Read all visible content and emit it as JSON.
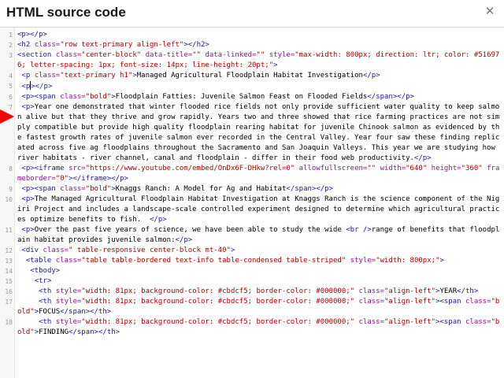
{
  "dialog": {
    "title": "HTML source code",
    "close_glyph": "✕"
  },
  "colors": {
    "tag": "#1a1aa6",
    "attribute": "#8b1a8b",
    "value": "#b30000",
    "marker": "#ff0000"
  },
  "lines": [
    {
      "num": "1",
      "tokens": [
        [
          "t",
          "<p></p>"
        ]
      ]
    },
    {
      "num": "2",
      "tokens": [
        [
          "t",
          "<h2 "
        ],
        [
          "a",
          "class="
        ],
        [
          "v",
          "\"row text-primary align-left\""
        ],
        [
          "t",
          "></h2>"
        ]
      ]
    },
    {
      "num": "3",
      "tokens": [
        [
          "t",
          "<section "
        ],
        [
          "a",
          "class="
        ],
        [
          "v",
          "\"center-block\" "
        ],
        [
          "a",
          "data-title="
        ],
        [
          "v",
          "\"\" "
        ],
        [
          "a",
          "data-linked="
        ],
        [
          "v",
          "\"\" "
        ],
        [
          "a",
          "style="
        ],
        [
          "v",
          "\"max-width: 800px; direction: ltr; color: #516976; letter-spacing: 1px; font-size: 14px; line-height: 20pt;\""
        ],
        [
          "t",
          ">"
        ]
      ]
    },
    {
      "num": "4",
      "tokens": [
        [
          "n",
          " "
        ],
        [
          "t",
          "<p "
        ],
        [
          "a",
          "class="
        ],
        [
          "v",
          "\"text-primary h1\""
        ],
        [
          "t",
          ">"
        ],
        [
          "n",
          "Managed Agricultural Floodplain Habitat Investigation"
        ],
        [
          "t",
          "</p>"
        ]
      ]
    },
    {
      "num": "5",
      "tokens": [
        [
          "n",
          " "
        ],
        [
          "t",
          "<p"
        ],
        [
          "c",
          ""
        ],
        [
          "t",
          "></p>"
        ]
      ]
    },
    {
      "num": "6",
      "tokens": [
        [
          "n",
          " "
        ],
        [
          "t",
          "<p><span "
        ],
        [
          "a",
          "class="
        ],
        [
          "v",
          "\"bold\""
        ],
        [
          "t",
          ">"
        ],
        [
          "n",
          "Floodplain Fatties: Juvenile Salmon Feast on Flooded Fields"
        ],
        [
          "t",
          "</span></p>"
        ]
      ]
    },
    {
      "num": "7",
      "tokens": [
        [
          "n",
          " "
        ],
        [
          "t",
          "<p>"
        ],
        [
          "n",
          "Year one demonstrated that winter flooded rice fields not only provide sufficient water quality to keep salmon alive but that they thrive and grow rapidly. Years two and three showed that rice farming practices are not simply compatible but provide high quality floodplain rearing habitat for juvenile Chinook salmon as evidenced by the fastest growth rates of juvenile salmon ever recorded in the Central Valley. Year four saw these finding replicated across five ag floodplains throughout the Sacramento and San Joaquin Valleys. This year we are studying how river habitats - river channel, canal and floodplain - differ in their food web productivity."
        ],
        [
          "t",
          "</p>"
        ]
      ]
    },
    {
      "num": "8",
      "tokens": [
        [
          "n",
          " "
        ],
        [
          "t",
          "<p><iframe "
        ],
        [
          "a",
          "src="
        ],
        [
          "v",
          "\"https://www.youtube.com/embed/OnDx6F-DHkw?rel=0\" "
        ],
        [
          "a",
          "allowfullscreen="
        ],
        [
          "v",
          "\"\" "
        ],
        [
          "a",
          "width="
        ],
        [
          "v",
          "\"640\" "
        ],
        [
          "a",
          "height="
        ],
        [
          "v",
          "\"360\" "
        ],
        [
          "a",
          "frameborder="
        ],
        [
          "v",
          "\"0\""
        ],
        [
          "t",
          "></iframe></p>"
        ]
      ]
    },
    {
      "num": "9",
      "tokens": [
        [
          "n",
          " "
        ],
        [
          "t",
          "<p><span "
        ],
        [
          "a",
          "class="
        ],
        [
          "v",
          "\"bold\""
        ],
        [
          "t",
          ">"
        ],
        [
          "n",
          "Knaggs Ranch: A Model for Ag and Habitat"
        ],
        [
          "t",
          "</span></p>"
        ]
      ]
    },
    {
      "num": "10",
      "tokens": [
        [
          "n",
          " "
        ],
        [
          "t",
          "<p>"
        ],
        [
          "n",
          "The Managed Agricultural Floodplain Habitat Investigation at Knaggs Ranch is the science component of the Nigiri Project and includes a landscape-scale controlled experiment designed to determine which agricultural practices optimize benefits to fish.  "
        ],
        [
          "t",
          "</p>"
        ]
      ]
    },
    {
      "num": "11",
      "tokens": [
        [
          "n",
          " "
        ],
        [
          "t",
          "<p>"
        ],
        [
          "n",
          "Over the past five years of science, we have been able to study the wide "
        ],
        [
          "t",
          "<br />"
        ],
        [
          "n",
          "range of benefits that floodplain habitat provides juvenile salmon:"
        ],
        [
          "t",
          "</p>"
        ]
      ]
    },
    {
      "num": "12",
      "tokens": [
        [
          "n",
          " "
        ],
        [
          "t",
          "<div "
        ],
        [
          "a",
          "class="
        ],
        [
          "v",
          "\" table-responsive center-block mt-40\""
        ],
        [
          "t",
          ">"
        ]
      ]
    },
    {
      "num": "13",
      "tokens": [
        [
          "n",
          "  "
        ],
        [
          "t",
          "<table "
        ],
        [
          "a",
          "class="
        ],
        [
          "v",
          "\"table table-bordered text-info table-condensed table-striped\" "
        ],
        [
          "a",
          "style="
        ],
        [
          "v",
          "\"width: 800px;\""
        ],
        [
          "t",
          ">"
        ]
      ]
    },
    {
      "num": "14",
      "tokens": [
        [
          "n",
          "   "
        ],
        [
          "t",
          "<tbody>"
        ]
      ]
    },
    {
      "num": "15",
      "tokens": [
        [
          "n",
          "    "
        ],
        [
          "t",
          "<tr>"
        ]
      ]
    },
    {
      "num": "16",
      "tokens": [
        [
          "n",
          "     "
        ],
        [
          "t",
          "<th "
        ],
        [
          "a",
          "style="
        ],
        [
          "v",
          "\"width: 81px; background-color: #cbdcf5; border-color: #000000;\" "
        ],
        [
          "a",
          "class="
        ],
        [
          "v",
          "\"align-left\""
        ],
        [
          "t",
          ">"
        ],
        [
          "n",
          "YEAR"
        ],
        [
          "t",
          "</th>"
        ]
      ]
    },
    {
      "num": "17",
      "tokens": [
        [
          "n",
          "     "
        ],
        [
          "t",
          "<th "
        ],
        [
          "a",
          "style="
        ],
        [
          "v",
          "\"width: 81px; background-color: #cbdcf5; border-color: #000000;\" "
        ],
        [
          "a",
          "class="
        ],
        [
          "v",
          "\"align-left\""
        ],
        [
          "t",
          "><span "
        ],
        [
          "a",
          "class="
        ],
        [
          "v",
          "\"bold\""
        ],
        [
          "t",
          ">"
        ],
        [
          "n",
          "FOCUS"
        ],
        [
          "t",
          "</span></th>"
        ]
      ]
    },
    {
      "num": "18",
      "tokens": [
        [
          "n",
          "     "
        ],
        [
          "t",
          "<th "
        ],
        [
          "a",
          "style="
        ],
        [
          "v",
          "\"width: 81px; background-color: #cbdcf5; border-color: #000000;\" "
        ],
        [
          "a",
          "class="
        ],
        [
          "v",
          "\"align-left\""
        ],
        [
          "t",
          "><span "
        ],
        [
          "a",
          "class="
        ],
        [
          "v",
          "\"bold\""
        ],
        [
          "t",
          ">"
        ],
        [
          "n",
          "FINDING"
        ],
        [
          "t",
          "</span></th>"
        ]
      ]
    }
  ]
}
